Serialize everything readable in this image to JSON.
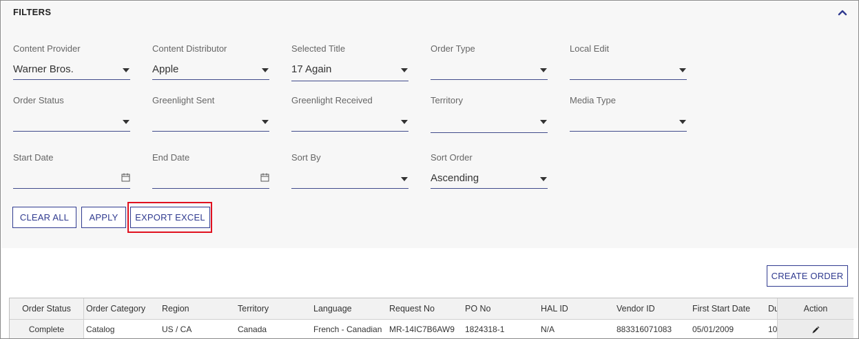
{
  "filters": {
    "title": "FILTERS",
    "fields": {
      "content_provider": {
        "label": "Content Provider",
        "value": "Warner Bros."
      },
      "content_distributor": {
        "label": "Content Distributor",
        "value": "Apple"
      },
      "selected_title": {
        "label": "Selected Title",
        "value": "17 Again"
      },
      "order_type": {
        "label": "Order Type",
        "value": ""
      },
      "local_edit": {
        "label": "Local Edit",
        "value": ""
      },
      "order_status": {
        "label": "Order Status",
        "value": ""
      },
      "greenlight_sent": {
        "label": "Greenlight Sent",
        "value": ""
      },
      "greenlight_received": {
        "label": "Greenlight Received",
        "value": ""
      },
      "territory": {
        "label": "Territory",
        "value": ""
      },
      "media_type": {
        "label": "Media Type",
        "value": ""
      },
      "start_date": {
        "label": "Start Date",
        "value": ""
      },
      "end_date": {
        "label": "End Date",
        "value": ""
      },
      "sort_by": {
        "label": "Sort By",
        "value": ""
      },
      "sort_order": {
        "label": "Sort Order",
        "value": "Ascending"
      }
    },
    "buttons": {
      "clear_all": "CLEAR ALL",
      "apply": "APPLY",
      "export_excel": "EXPORT EXCEL"
    }
  },
  "create_order_label": "CREATE ORDER",
  "table": {
    "headers": {
      "order_status": "Order Status",
      "order_category": "Order Category",
      "region": "Region",
      "territory": "Territory",
      "language": "Language",
      "request_no": "Request No",
      "po_no": "PO No",
      "hal_id": "HAL ID",
      "vendor_id": "Vendor ID",
      "first_start_date": "First Start Date",
      "due": "Du",
      "action": "Action"
    },
    "rows": [
      {
        "order_status": "Complete",
        "order_category": "Catalog",
        "region": "US / CA",
        "territory": "Canada",
        "language": "French - Canadian",
        "request_no": "MR-14IC7B6AW9",
        "po_no": "1824318-1",
        "hal_id": "N/A",
        "vendor_id": "883316071083",
        "first_start_date": "05/01/2009",
        "due": "10"
      }
    ]
  },
  "colors": {
    "accent": "#2f3a8f",
    "highlight": "#e0101e",
    "panel_bg": "#f7f7f7"
  },
  "icons": {
    "collapse": "chevron-up-icon",
    "dropdown": "caret-down-icon",
    "date": "calendar-icon",
    "edit": "pencil-icon"
  }
}
